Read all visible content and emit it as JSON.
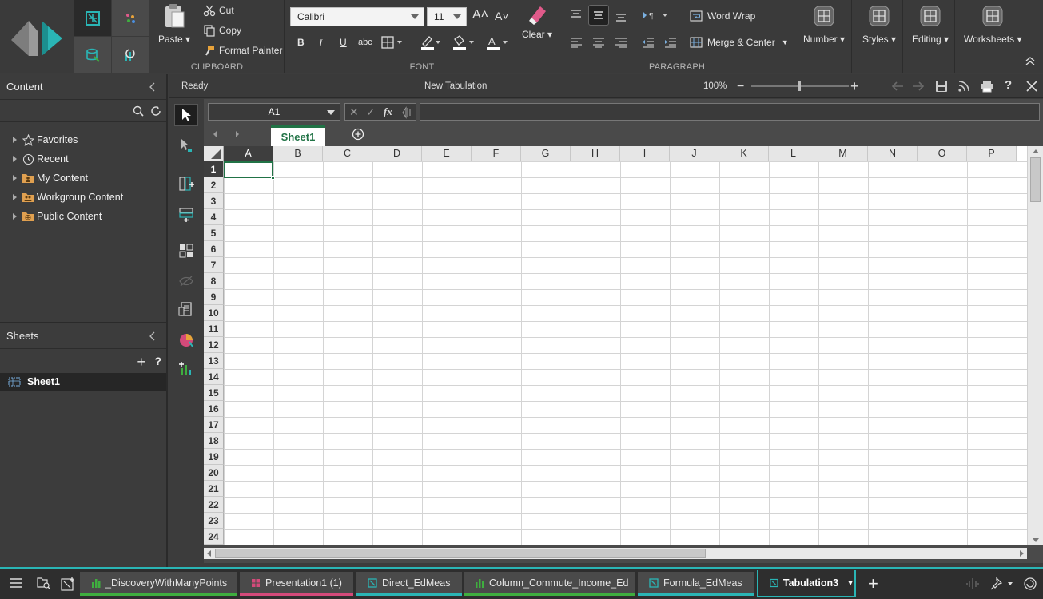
{
  "ribbon": {
    "clipboard": {
      "group_label": "CLIPBOARD",
      "paste": "Paste ▾",
      "cut": "Cut",
      "copy": "Copy",
      "format_painter": "Format Painter"
    },
    "font": {
      "group_label": "FONT",
      "font_name": "Calibri",
      "font_size": "11",
      "clear": "Clear ▾"
    },
    "paragraph": {
      "group_label": "PARAGRAPH",
      "word_wrap": "Word Wrap",
      "merge_center": "Merge & Center"
    },
    "number": "Number ▾",
    "styles": "Styles ▾",
    "editing": "Editing ▾",
    "worksheets": "Worksheets ▾"
  },
  "content_panel": {
    "title": "Content",
    "items": [
      {
        "label": "Favorites",
        "icon": "star-icon"
      },
      {
        "label": "Recent",
        "icon": "clock-icon"
      },
      {
        "label": "My Content",
        "icon": "folder-user-icon"
      },
      {
        "label": "Workgroup Content",
        "icon": "folder-group-icon"
      },
      {
        "label": "Public Content",
        "icon": "folder-globe-icon"
      }
    ]
  },
  "sheets_panel": {
    "title": "Sheets",
    "items": [
      {
        "label": "Sheet1"
      }
    ]
  },
  "status": {
    "state": "Ready",
    "doc_title": "New Tabulation",
    "zoom": "100%"
  },
  "formula_bar": {
    "name_box": "A1",
    "formula": ""
  },
  "sheet_tabs": [
    {
      "label": "Sheet1"
    }
  ],
  "grid": {
    "columns": [
      "A",
      "B",
      "C",
      "D",
      "E",
      "F",
      "G",
      "H",
      "I",
      "J",
      "K",
      "L",
      "M",
      "N",
      "O",
      "P"
    ],
    "rows": [
      "1",
      "2",
      "3",
      "4",
      "5",
      "6",
      "7",
      "8",
      "9",
      "10",
      "11",
      "12",
      "13",
      "14",
      "15",
      "16",
      "17",
      "18",
      "19",
      "20",
      "21",
      "22",
      "23",
      "24"
    ],
    "selected_cell": "A1"
  },
  "taskbar": {
    "tabs": [
      {
        "label": "_DiscoveryWithManyPoints",
        "icon": "bar-chart-icon",
        "accent": "#3fae3f"
      },
      {
        "label": "Presentation1 (1)",
        "icon": "presentation-icon",
        "accent": "#d44a7a"
      },
      {
        "label": "Direct_EdMeas",
        "icon": "tabulation-icon",
        "accent": "#2ab5b5"
      },
      {
        "label": "Column_Commute_Income_Ed",
        "icon": "bar-chart-icon",
        "accent": "#3fae3f"
      },
      {
        "label": "Formula_EdMeas",
        "icon": "tabulation-icon",
        "accent": "#2ab5b5"
      },
      {
        "label": "Tabulation3",
        "icon": "tabulation-icon",
        "accent": "#2ab5b5",
        "active": true
      }
    ]
  },
  "colors": {
    "accent": "#2ab5b5",
    "selection_green": "#217346",
    "chart_green": "#3fae3f",
    "presentation_pink": "#d44a7a"
  }
}
